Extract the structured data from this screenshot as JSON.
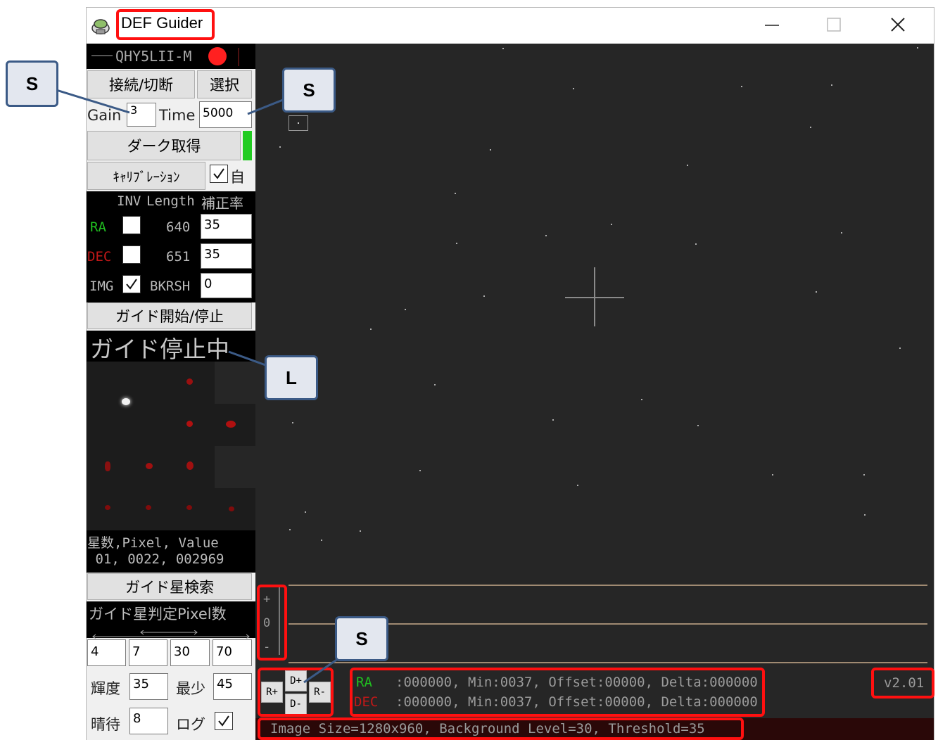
{
  "window": {
    "title": "DEF Guider",
    "version": "v2.01"
  },
  "camera": {
    "name": "QHY5LII-M",
    "connect_label": "接続/切断",
    "select_label": "選択"
  },
  "exposure": {
    "gain_label": "Gain",
    "gain_value": "3",
    "time_label": "Time",
    "time_value": "5000"
  },
  "dark_label": "ダーク取得",
  "calibration": {
    "label": "ｷｬﾘﾌﾞﾚｰｼｮﾝ",
    "auto_label": "自"
  },
  "params": {
    "header_inv": "INV",
    "header_length": "Length",
    "header_rate": "補正率",
    "ra_label": "RA",
    "ra_length": "640",
    "ra_rate": "35",
    "dec_label": "DEC",
    "dec_length": "651",
    "dec_rate": "35",
    "img_label": "IMG",
    "bkrsh_label": "BKRSH",
    "bkrsh_value": "0"
  },
  "guide": {
    "start_stop_label": "ガイド開始/停止",
    "status": "ガイド停止中"
  },
  "star_info": {
    "header": "星数,Pixel, Value",
    "values": " 01, 0022, 002969"
  },
  "search_label": "ガイド星検索",
  "pixel_judge": {
    "label": "ガイド星判定Pixel数",
    "v1": "4",
    "v2": "7",
    "v3": "30",
    "v4": "70"
  },
  "bottom": {
    "brightness_label": "輝度",
    "brightness_value": "35",
    "min_label": "最少",
    "min_value": "45",
    "wait_label": "晴待",
    "wait_value": "8",
    "log_label": "ログ"
  },
  "graph_scale": {
    "plus": "+",
    "zero": "0",
    "minus": "-"
  },
  "direction": {
    "dplus": "D+",
    "dminus": "D-",
    "rplus": "R+",
    "rminus": "R-"
  },
  "status_lines": {
    "ra_label": "RA",
    "ra_text": ":000000, Min:0037, Offset:00000, Delta:000000",
    "dec_label": "DEC",
    "dec_text": ":000000, Min:0037, Offset:00000, Delta:000000",
    "image_info": "Image Size=1280x960, Background Level=30, Threshold=35"
  },
  "annotations": {
    "s1": "S",
    "s2": "S",
    "l": "L",
    "s3": "S"
  },
  "colors": {
    "ra": "#20c020",
    "dec": "#c01818",
    "highlight": "#ff1010",
    "callout_border": "#3b5a86"
  }
}
